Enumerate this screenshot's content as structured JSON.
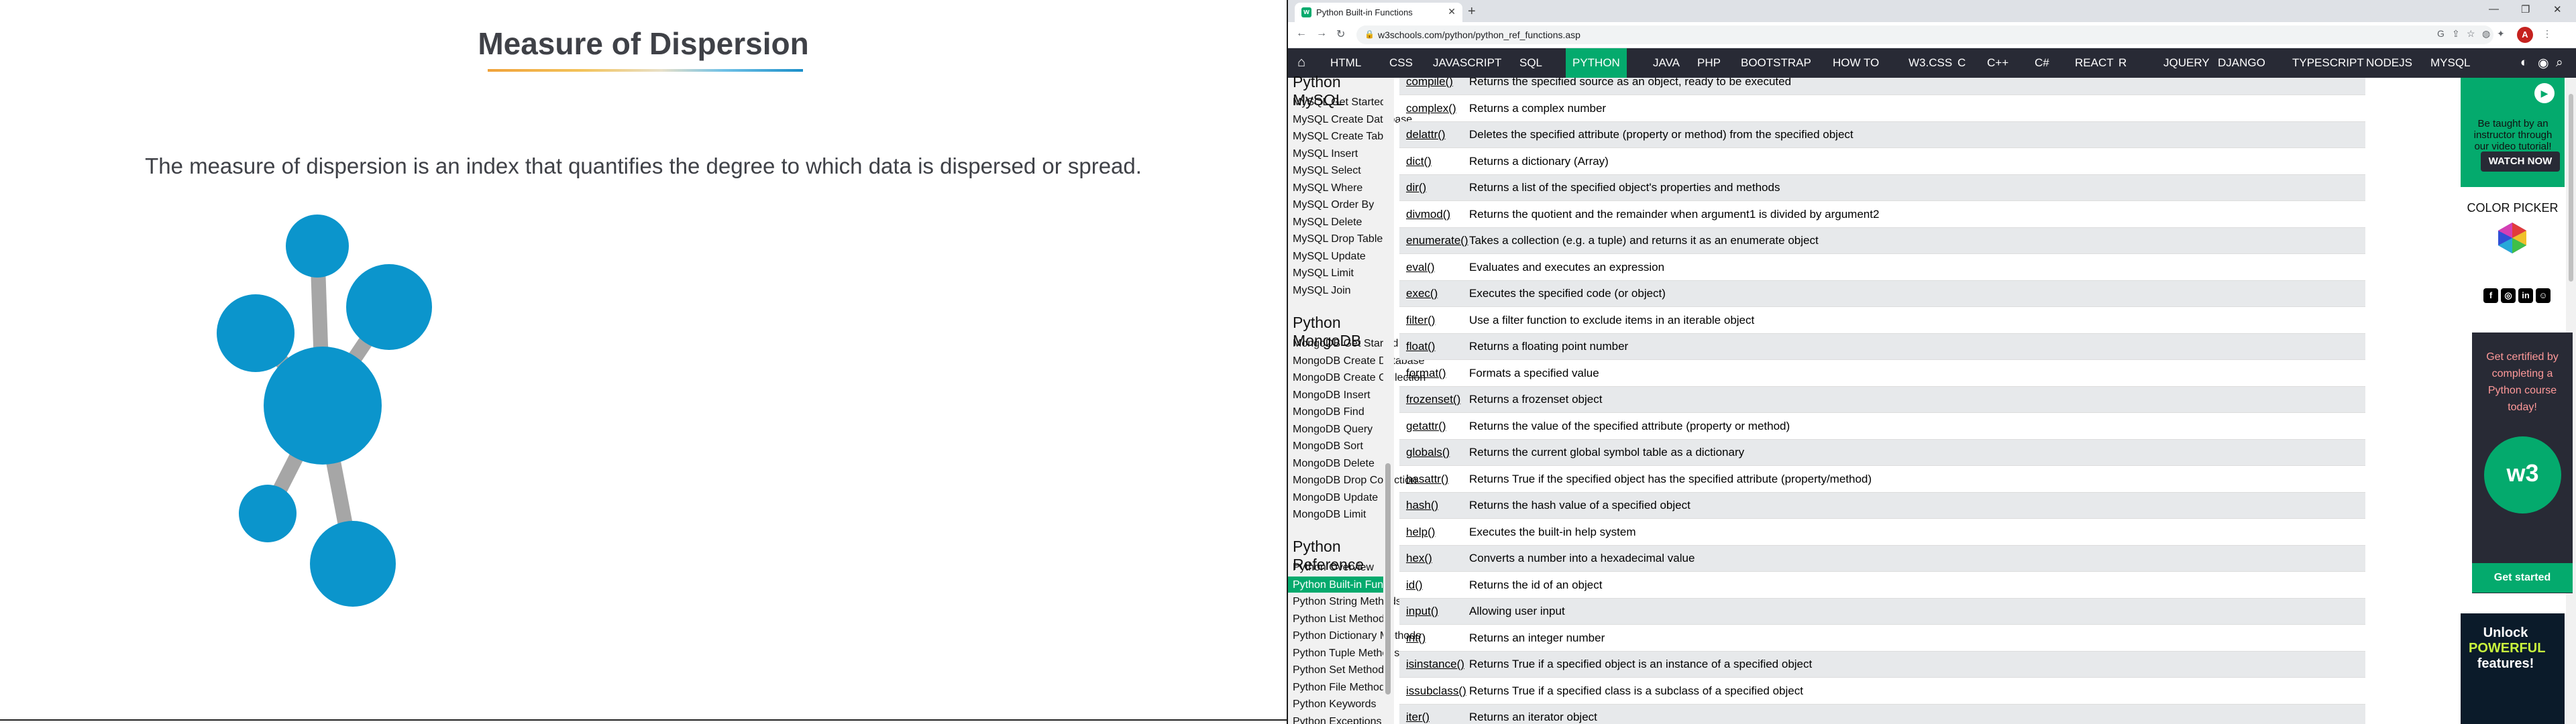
{
  "slide": {
    "title": "Measure of Dispersion",
    "description": "The measure of dispersion is an index that quantifies the degree to which data is dispersed or spread."
  },
  "browser": {
    "tab_title": "Python Built-in Functions",
    "url": "w3schools.com/python/python_ref_functions.asp",
    "avatar_letter": "A",
    "topnav": [
      "HTML",
      "CSS",
      "JAVASCRIPT",
      "SQL",
      "PYTHON",
      "JAVA",
      "PHP",
      "BOOTSTRAP",
      "HOW TO",
      "W3.CSS",
      "C",
      "C++",
      "C#",
      "REACT",
      "R",
      "JQUERY",
      "DJANGO",
      "TYPESCRIPT",
      "NODEJS",
      "MYSQL"
    ],
    "active_nav": "PYTHON",
    "accent": "#04aa6d",
    "nav_bg": "#282a35"
  },
  "sidebar": {
    "mysql_heading": "Python MySQL",
    "mysql_items": [
      "MySQL Get Started",
      "MySQL Create Database",
      "MySQL Create Table",
      "MySQL Insert",
      "MySQL Select",
      "MySQL Where",
      "MySQL Order By",
      "MySQL Delete",
      "MySQL Drop Table",
      "MySQL Update",
      "MySQL Limit",
      "MySQL Join"
    ],
    "mongo_heading": "Python MongoDB",
    "mongo_items": [
      "MongoDB Get Started",
      "MongoDB Create Database",
      "MongoDB Create Collection",
      "MongoDB Insert",
      "MongoDB Find",
      "MongoDB Query",
      "MongoDB Sort",
      "MongoDB Delete",
      "MongoDB Drop Collection",
      "MongoDB Update",
      "MongoDB Limit"
    ],
    "ref_heading": "Python Reference",
    "ref_items": [
      "Python Overview",
      "Python Built-in Functions",
      "Python String Methods",
      "Python List Methods",
      "Python Dictionary Methods",
      "Python Tuple Methods",
      "Python Set Methods",
      "Python File Methods",
      "Python Keywords",
      "Python Exceptions"
    ],
    "active_item": "Python Built-in Functions"
  },
  "functions": [
    {
      "name": "compile()",
      "desc": "Returns the specified source as an object, ready to be executed"
    },
    {
      "name": "complex()",
      "desc": "Returns a complex number"
    },
    {
      "name": "delattr()",
      "desc": "Deletes the specified attribute (property or method) from the specified object"
    },
    {
      "name": "dict()",
      "desc": "Returns a dictionary (Array)"
    },
    {
      "name": "dir()",
      "desc": "Returns a list of the specified object's properties and methods"
    },
    {
      "name": "divmod()",
      "desc": "Returns the quotient and the remainder when argument1 is divided by argument2"
    },
    {
      "name": "enumerate()",
      "desc": "Takes a collection (e.g. a tuple) and returns it as an enumerate object"
    },
    {
      "name": "eval()",
      "desc": "Evaluates and executes an expression"
    },
    {
      "name": "exec()",
      "desc": "Executes the specified code (or object)"
    },
    {
      "name": "filter()",
      "desc": "Use a filter function to exclude items in an iterable object"
    },
    {
      "name": "float()",
      "desc": "Returns a floating point number"
    },
    {
      "name": "format()",
      "desc": "Formats a specified value"
    },
    {
      "name": "frozenset()",
      "desc": "Returns a frozenset object"
    },
    {
      "name": "getattr()",
      "desc": "Returns the value of the specified attribute (property or method)"
    },
    {
      "name": "globals()",
      "desc": "Returns the current global symbol table as a dictionary"
    },
    {
      "name": "hasattr()",
      "desc": "Returns True if the specified object has the specified attribute (property/method)"
    },
    {
      "name": "hash()",
      "desc": "Returns the hash value of a specified object"
    },
    {
      "name": "help()",
      "desc": "Executes the built-in help system"
    },
    {
      "name": "hex()",
      "desc": "Converts a number into a hexadecimal value"
    },
    {
      "name": "id()",
      "desc": "Returns the id of an object"
    },
    {
      "name": "input()",
      "desc": "Allowing user input"
    },
    {
      "name": "int()",
      "desc": "Returns an integer number"
    },
    {
      "name": "isinstance()",
      "desc": "Returns True if a specified object is an instance of a specified object"
    },
    {
      "name": "issubclass()",
      "desc": "Returns True if a specified class is a subclass of a specified object"
    },
    {
      "name": "iter()",
      "desc": "Returns an iterator object"
    }
  ],
  "ads": {
    "video_text": "Be taught by an instructor through our video tutorial!",
    "watch_label": "WATCH NOW",
    "color_picker_label": "COLOR PICKER",
    "cert_text": "Get certified by completing a Python course today!",
    "cert_badge": "w3",
    "get_started_label": "Get started",
    "unlock_text_1": "Unlock",
    "unlock_text_2": "POWERFUL",
    "unlock_text_3": "features!"
  }
}
